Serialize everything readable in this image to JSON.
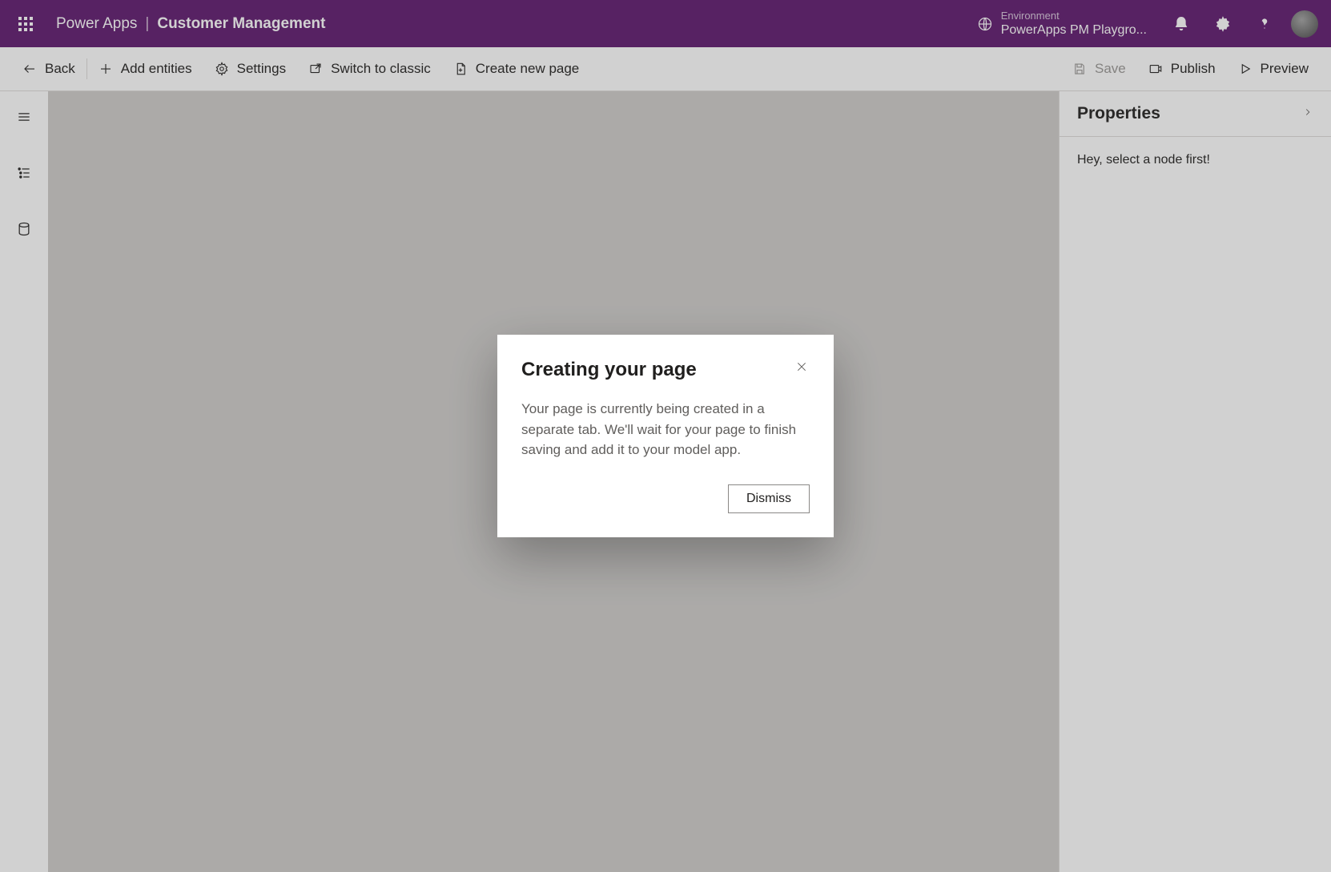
{
  "header": {
    "product": "Power Apps",
    "separator": "|",
    "app_name": "Customer Management",
    "environment_label": "Environment",
    "environment_name": "PowerApps PM Playgro..."
  },
  "command_bar": {
    "back": "Back",
    "add_entities": "Add entities",
    "settings": "Settings",
    "switch_classic": "Switch to classic",
    "create_page": "Create new page",
    "save": "Save",
    "publish": "Publish",
    "preview": "Preview"
  },
  "properties": {
    "title": "Properties",
    "empty_message": "Hey, select a node first!"
  },
  "dialog": {
    "title": "Creating your page",
    "body": "Your page is currently being created in a separate tab. We'll wait for your page to finish saving and add it to your model app.",
    "dismiss": "Dismiss"
  }
}
